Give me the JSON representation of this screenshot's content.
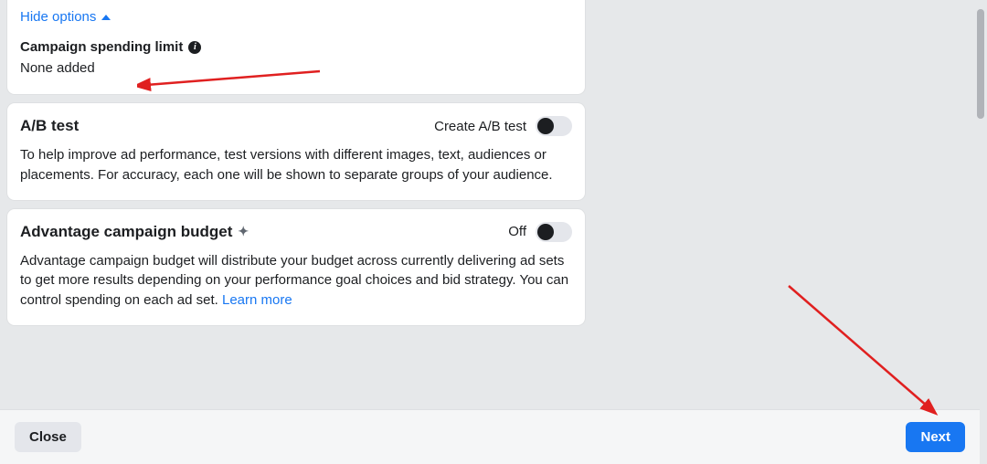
{
  "hide_options_label": "Hide options",
  "spending_limit": {
    "label": "Campaign spending limit",
    "value": "None added"
  },
  "ab_test": {
    "title": "A/B test",
    "toggle_label": "Create A/B test",
    "description": "To help improve ad performance, test versions with different images, text, audiences or placements. For accuracy, each one will be shown to separate groups of your audience."
  },
  "adv_budget": {
    "title": "Advantage campaign budget",
    "toggle_label": "Off",
    "description": "Advantage campaign budget will distribute your budget across currently delivering ad sets to get more results depending on your performance goal choices and bid strategy. You can control spending on each ad set.",
    "learn_more": "Learn more"
  },
  "footer": {
    "close": "Close",
    "next": "Next"
  }
}
